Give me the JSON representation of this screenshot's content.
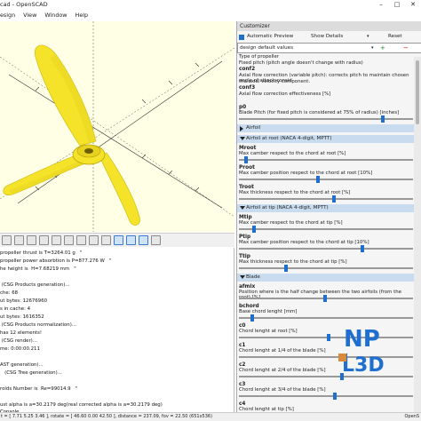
{
  "window": {
    "title": "cad - OpenSCAD"
  },
  "menu": [
    "esign",
    "View",
    "Window",
    "Help"
  ],
  "customizer": {
    "title": "Customizer",
    "auto_preview": "Automatic Preview",
    "show_details": "Show Details",
    "reset": "Reset",
    "preset": "design default values",
    "lines": [
      {
        "kind": "desc",
        "text": "Type of propeller"
      },
      {
        "kind": "desc",
        "text": "Fixed pitch (pitch angle doesn't change with radius)"
      },
      {
        "kind": "name",
        "text": "conf2"
      },
      {
        "kind": "desc",
        "text": "Axial flow correction (variable pitch): corrects pitch to maintain chosen angle of attack consid"
      },
      {
        "kind": "desc",
        "text": "the axial velocity component."
      },
      {
        "kind": "name",
        "text": "conf3"
      },
      {
        "kind": "desc",
        "text": "Axial flow correction effectiveness [%]"
      }
    ],
    "params": [
      {
        "name": "p0",
        "desc": "Blade Pitch (for fixed pitch is considered at 75% of radius) [inches]",
        "value": 0.84
      },
      {
        "section": "Airfoil",
        "open": false
      },
      {
        "section": "Airfoil at root (NACA 4-digit, MPTT)",
        "open": true
      },
      {
        "name": "Mroot",
        "desc": "Max camber respect to the chord at root [%]",
        "value": 0.03
      },
      {
        "name": "Proot",
        "desc": "Max camber position respect to the chord at root [10%]",
        "value": 0.46
      },
      {
        "name": "Troot",
        "desc": "Max thickness respect to the chord at root [%]",
        "value": 0.55
      },
      {
        "section": "Airfoil at tip (NACA 4-digit, MPTT)",
        "open": true
      },
      {
        "name": "Mtip",
        "desc": "Max camber respect to the chord at tip [%]",
        "value": 0.08
      },
      {
        "name": "Ptip",
        "desc": "Max camber position respect to the chord at tip [10%]",
        "value": 0.72
      },
      {
        "name": "Ttip",
        "desc": "Max thickness respect to the chord at tip [%]",
        "value": 0.27
      },
      {
        "section": "Blade",
        "open": true
      },
      {
        "name": "afmix",
        "desc": "Position where is the half change between the two airfoils (from the root) [%]",
        "value": 0.5
      },
      {
        "name": "bchord",
        "desc": "Base chord lenght [mm]",
        "value": 0.07
      },
      {
        "name": "c0",
        "desc": "Chord lenght at root [%]",
        "value": 0.52
      },
      {
        "name": "c1",
        "desc": "Chord lenght at 1/4 of the blade [%]",
        "value": 0.62
      },
      {
        "name": "c2",
        "desc": "Chord lenght at 2/4 of the blade [%]",
        "value": 0.6
      },
      {
        "name": "c3",
        "desc": "Chord lenght at 3/4 of the blade [%]",
        "value": 0.56
      },
      {
        "name": "c4",
        "desc": "Chord lenght at tip [%]",
        "value": 0.3
      }
    ]
  },
  "console": {
    "label": "Console",
    "lines": [
      "propeller thrust is T=3264.01 g   \"",
      "propeller power absorbtion is P=877.276 W   \"",
      "he height is  H=7.68219 mm   \"",
      "",
      " (CSG Products generation)...",
      "che: 68",
      "ut bytes: 12676960",
      "s in cache: 4",
      "ut bytes: 1616352",
      " (CSG Products normalization)...",
      "has 12 elements!",
      " (CSG render)...",
      "me: 0:00:00.211",
      "",
      "AST generation)...",
      "   (CSG Tree generation)...",
      "",
      "rolds Number is  Re=99014.9   \"",
      "",
      "ust alpha is a=30.2179 deg(real corrected alpha is a=30.2179 deg)"
    ]
  },
  "status": {
    "text": "t = [ 7.71 5.25 3.46 ], rotate = [ 46.60 0.00 42.50 ], distance = 237.09, fov = 22.50 (651x536)",
    "app": "OpenS"
  },
  "logo": {
    "line1": "NP",
    "line2": "L3D"
  },
  "colors": {
    "viewport": "#ffffe5",
    "model": "#f5e32a",
    "accent": "#1f6fd0",
    "section": "#c9dcef"
  }
}
